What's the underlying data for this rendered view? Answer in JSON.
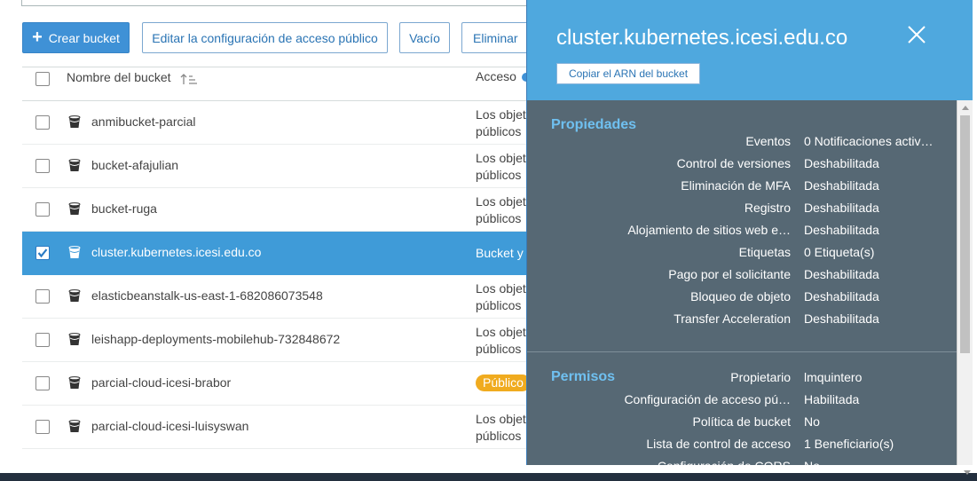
{
  "toolbar": {
    "create_label": "Crear bucket",
    "edit_public_access_label": "Editar la configuración de acceso público",
    "empty_label": "Vacío",
    "delete_label": "Eliminar"
  },
  "table": {
    "col_name": "Nombre del bucket",
    "col_access": "Acceso",
    "rows": [
      {
        "name": "anmibucket-parcial",
        "access_l1": "Los objet",
        "access_l2": "públicos",
        "checked": false
      },
      {
        "name": "bucket-afajulian",
        "access_l1": "Los objet",
        "access_l2": "públicos",
        "checked": false
      },
      {
        "name": "bucket-ruga",
        "access_l1": "Los objet",
        "access_l2": "públicos",
        "checked": false
      },
      {
        "name": "cluster.kubernetes.icesi.edu.co",
        "access_l1": "Bucket y",
        "access_l2": "",
        "checked": true
      },
      {
        "name": "elasticbeanstalk-us-east-1-682086073548",
        "access_l1": "Los objet",
        "access_l2": "públicos",
        "checked": false
      },
      {
        "name": "leishapp-deployments-mobilehub-732848672",
        "access_l1": "Los objet",
        "access_l2": "públicos",
        "checked": false
      },
      {
        "name": "parcial-cloud-icesi-brabor",
        "badge": "Público",
        "checked": false
      },
      {
        "name": "parcial-cloud-icesi-luisyswan",
        "access_l1": "Los objet",
        "access_l2": "públicos",
        "checked": false
      }
    ]
  },
  "panel": {
    "title": "cluster.kubernetes.icesi.edu.co",
    "copy_arn_label": "Copiar el ARN del bucket",
    "properties_title": "Propiedades",
    "properties": [
      {
        "key": "Eventos",
        "value": "0 Notificaciones activ…"
      },
      {
        "key": "Control de versiones",
        "value": "Deshabilitada"
      },
      {
        "key": "Eliminación de MFA",
        "value": "Deshabilitada"
      },
      {
        "key": "Registro",
        "value": "Deshabilitada"
      },
      {
        "key": "Alojamiento de sitios web e…",
        "value": "Deshabilitada"
      },
      {
        "key": "Etiquetas",
        "value": "0 Etiqueta(s)"
      },
      {
        "key": "Pago por el solicitante",
        "value": "Deshabilitada"
      },
      {
        "key": "Bloqueo de objeto",
        "value": "Deshabilitada"
      },
      {
        "key": "Transfer Acceleration",
        "value": "Deshabilitada"
      }
    ],
    "permissions_title": "Permisos",
    "permissions": [
      {
        "key": "Propietario",
        "value": "lmquintero"
      },
      {
        "key": "Configuración de acceso pú…",
        "value": "Habilitada"
      },
      {
        "key": "Política de bucket",
        "value": "No"
      },
      {
        "key": "Lista de control de acceso",
        "value": "1 Beneficiario(s)"
      },
      {
        "key": "Configuración de CORS",
        "value": "No"
      }
    ]
  },
  "colors": {
    "primary": "#3f91d6",
    "selected_row": "#3f9bd8",
    "panel_header": "#4fa8de",
    "panel_body": "#566874",
    "section_title": "#6fc0f0",
    "badge_public": "#f0ab1f"
  }
}
